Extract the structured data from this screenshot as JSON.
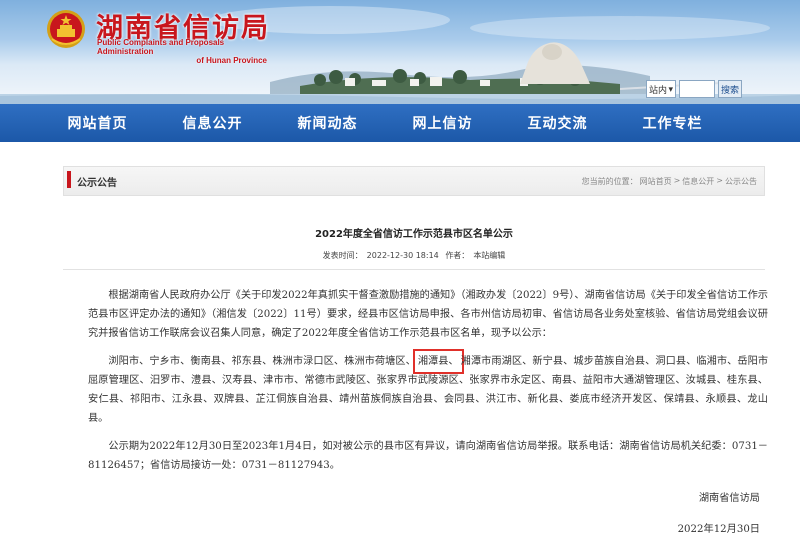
{
  "header": {
    "site_title": "湖南省信访局",
    "subtitle_line1": "Public Complaints and Proposals Administration",
    "subtitle_line2": "of Hunan Province",
    "search": {
      "scope_label": "站内",
      "query": "",
      "button_label": "搜索"
    }
  },
  "nav": {
    "items": [
      {
        "label": "网站首页"
      },
      {
        "label": "信息公开"
      },
      {
        "label": "新闻动态"
      },
      {
        "label": "网上信访"
      },
      {
        "label": "互动交流"
      },
      {
        "label": "工作专栏"
      }
    ]
  },
  "section": {
    "title": "公示公告",
    "breadcrumb": {
      "prefix": "您当前的位置：",
      "items": [
        "网站首页",
        "信息公开",
        "公示公告"
      ],
      "separator": ">"
    }
  },
  "article": {
    "title": "2022年度全省信访工作示范县市区名单公示",
    "publish_label": "发表时间：",
    "publish_time": "2022-12-30 18:14",
    "author_label": "作者：",
    "author": "本站编辑",
    "para1": "根据湖南省人民政府办公厅《关于印发2022年真抓实干督查激励措施的通知》（湘政办发〔2022〕9号）、湖南省信访局《关于印发全省信访工作示范县市区评定办法的通知》（湘信发〔2022〕11号）要求，经县市区信访局申报、各市州信访局初审、省信访局各业务处室核验、省信访局党组会议研究并报省信访工作联席会议召集人同意，确定了2022年度全省信访工作示范县市区名单，现予以公示：",
    "list_before": "浏阳市、宁乡市、衡南县、祁东县、株洲市渌口区、株洲市荷塘区、",
    "list_highlight": "湘潭县、",
    "list_after": "湘潭市雨湖区、新宁县、城步苗族自治县、洞口县、临湘市、岳阳市屈原管理区、汨罗市、澧县、汉寿县、津市市、常德市武陵区、张家界市武陵源区、张家界市永定区、南县、益阳市大通湖管理区、汝城县、桂东县、安仁县、祁阳市、江永县、双牌县、芷江侗族自治县、靖州苗族侗族自治县、会同县、洪江市、新化县、娄底市经济开发区、保靖县、永顺县、龙山县。",
    "para3": "公示期为2022年12月30日至2023年1月4日，如对被公示的县市区有异议，请向湖南省信访局举报。联系电话：湖南省信访局机关纪委：0731－81126457；省信访局接访一处：0731－81127943。",
    "signature": "湖南省信访局",
    "date": "2022年12月30日"
  },
  "colors": {
    "brand_red": "#c8161d",
    "nav_blue": "#1c58a8",
    "highlight_box": "#e0302a"
  },
  "icons": {
    "emblem": "national-emblem-icon",
    "dropdown": "chevron-down-icon"
  }
}
